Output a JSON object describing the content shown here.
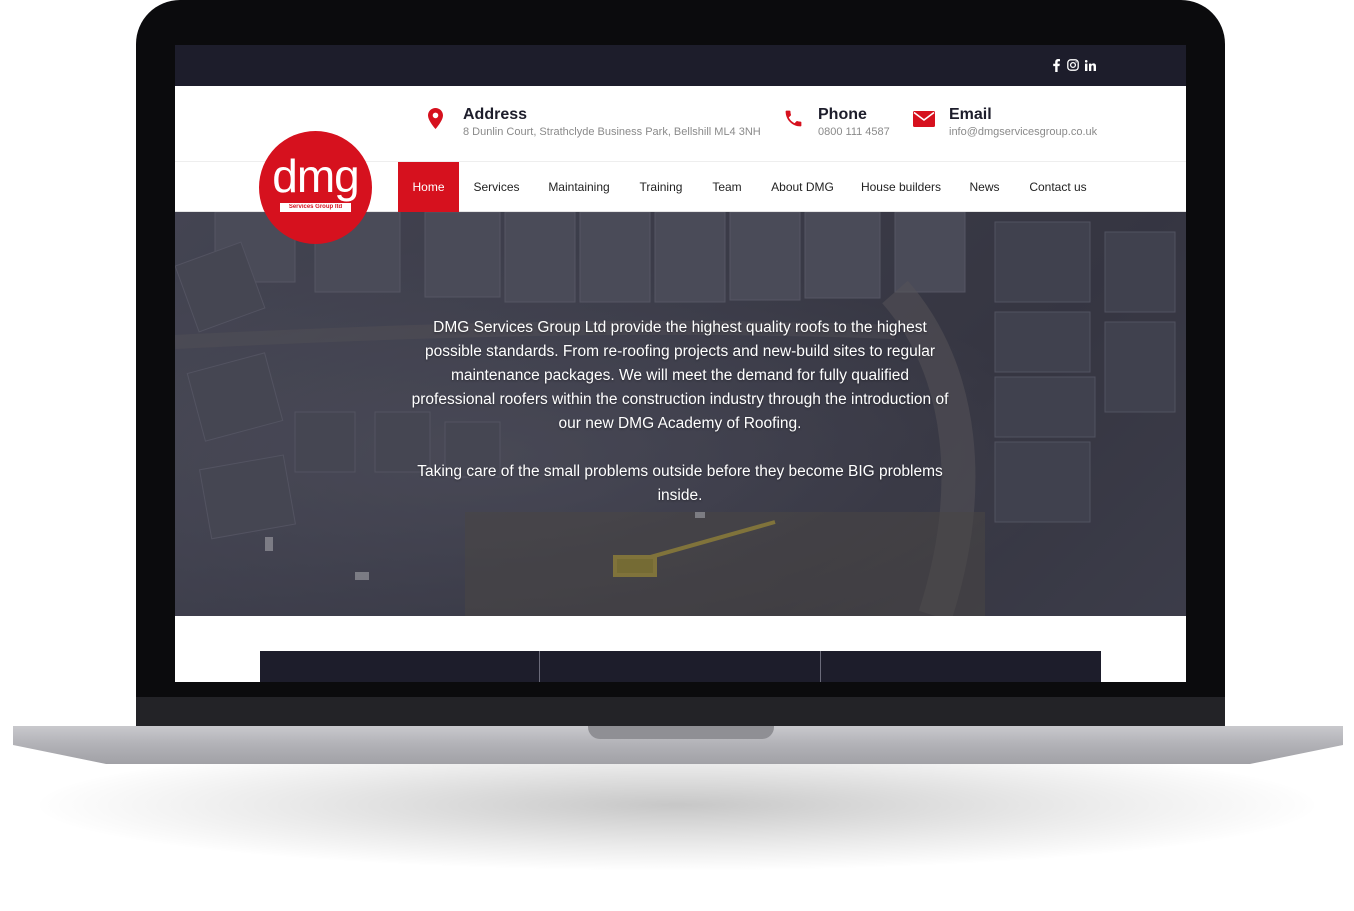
{
  "social": {
    "icons": [
      "facebook-icon",
      "instagram-icon",
      "linkedin-icon"
    ]
  },
  "contact": {
    "address": {
      "icon": "map-pin-icon",
      "title": "Address",
      "detail": "8 Dunlin Court, Strathclyde Business Park, Bellshill ML4 3NH"
    },
    "phone": {
      "icon": "phone-icon",
      "title": "Phone",
      "detail": "0800 111 4587"
    },
    "email": {
      "icon": "envelope-icon",
      "title": "Email",
      "detail": "info@dmgservicesgroup.co.uk"
    }
  },
  "logo": {
    "word": "dmg",
    "tagline": "Services Group ltd"
  },
  "nav": {
    "items": [
      {
        "label": "Home",
        "active": true
      },
      {
        "label": "Services"
      },
      {
        "label": "Maintaining"
      },
      {
        "label": "Training"
      },
      {
        "label": "Team"
      },
      {
        "label": "About DMG"
      },
      {
        "label": "House builders"
      },
      {
        "label": "News"
      },
      {
        "label": "Contact us"
      }
    ]
  },
  "hero": {
    "paragraph_1": "DMG Services Group Ltd provide the highest quality roofs to the highest possible standards. From re-roofing projects and new-build sites to regular maintenance packages. We will meet the demand for fully qualified professional roofers within the construction industry through the introduction of our new DMG Academy of Roofing.",
    "paragraph_2": "Taking care of the small problems outside before they become BIG problems inside."
  },
  "colors": {
    "accent": "#d6111e",
    "dark": "#1d1d2b"
  }
}
